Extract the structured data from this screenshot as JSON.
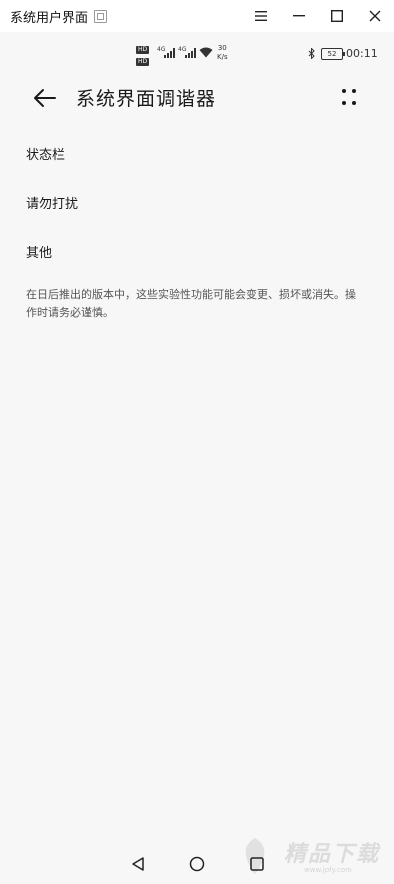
{
  "window": {
    "title": "系统用户界面"
  },
  "status": {
    "net_speed_value": "30",
    "net_speed_unit": "K/s",
    "hd1": "HD",
    "hd2": "HD",
    "lte1": "4G",
    "lte2": "4G",
    "battery": "52",
    "time": "00:11"
  },
  "app": {
    "title": "系统界面调谐器"
  },
  "menu": [
    {
      "label": "状态栏"
    },
    {
      "label": "请勿打扰"
    },
    {
      "label": "其他"
    }
  ],
  "note": "在日后推出的版本中，这些实验性功能可能会变更、损坏或消失。操作时请务必谨慎。",
  "watermark": {
    "text": "精品下载",
    "url": "www.jpfy.com"
  },
  "colors": {
    "background": "#f7f7f7",
    "text": "#1a1a1a",
    "muted": "#555555"
  }
}
